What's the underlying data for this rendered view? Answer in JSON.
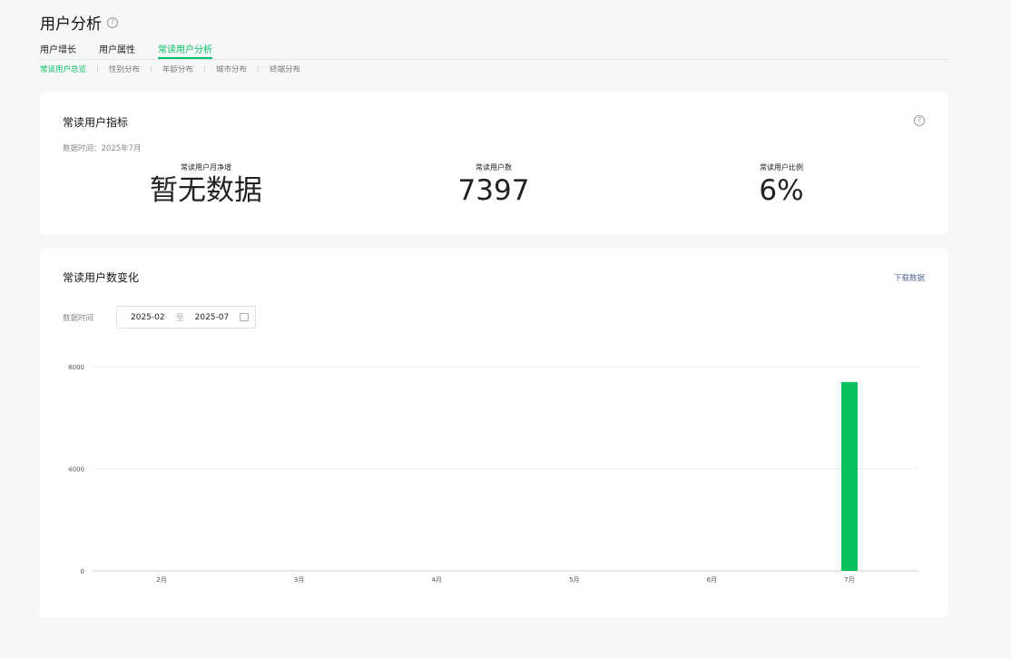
{
  "header": {
    "title": "用户分析",
    "tabs": [
      "用户增长",
      "用户属性",
      "常读用户分析"
    ],
    "active_tab": 2,
    "subtabs": [
      "常读用户总览",
      "性别分布",
      "年龄分布",
      "城市分布",
      "终端分布"
    ],
    "active_subtab": 0
  },
  "metrics_card": {
    "title": "常读用户指标",
    "data_time": "数据时间：2025年7月",
    "metrics": [
      {
        "label": "常读用户月净增",
        "value": "暂无数据"
      },
      {
        "label": "常读用户数",
        "value": "7397"
      },
      {
        "label": "常读用户比例",
        "value": "6%"
      }
    ]
  },
  "trend_card": {
    "title": "常读用户数变化",
    "download_label": "下载数据",
    "date_label": "数据时间",
    "date_start": "2025-02",
    "date_to": "至",
    "date_end": "2025-07"
  },
  "colors": {
    "accent": "#07c160",
    "link": "#576b95"
  },
  "chart_data": {
    "type": "bar",
    "categories": [
      "2月",
      "3月",
      "4月",
      "5月",
      "6月",
      "7月"
    ],
    "values": [
      0,
      0,
      0,
      0,
      0,
      7397
    ],
    "y_ticks": [
      "0",
      "4000",
      "8000"
    ],
    "ylim": [
      0,
      8000
    ],
    "grid": true
  }
}
